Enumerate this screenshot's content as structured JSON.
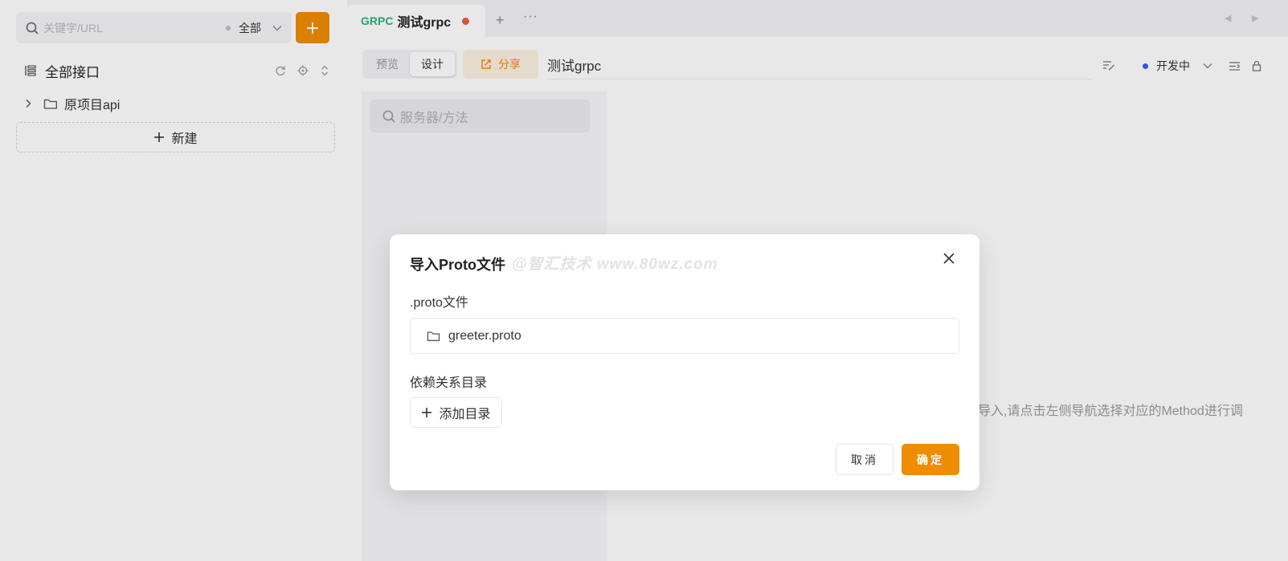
{
  "sidebar": {
    "search": {
      "placeholder": "关键字/URL",
      "filter_value": "全部"
    },
    "add_button_label": "+",
    "tree_title": "全部接口",
    "folder": {
      "label": "原项目api"
    },
    "new_button_label": "新建"
  },
  "tab": {
    "protocol": "GRPC",
    "name": "测试grpc",
    "add_label": "+",
    "more_label": "···"
  },
  "toolbar": {
    "preview_label": "预览",
    "design_label": "设计",
    "share_label": "分享",
    "doc_name": "测试grpc",
    "status_label": "开发中"
  },
  "content": {
    "service_search_placeholder": "服务器/方法",
    "empty_hint": "导入,请点击左侧导航选择对应的Method进行调"
  },
  "modal": {
    "title": "导入Proto文件",
    "watermark": "@智汇技术 www.80wz.com",
    "proto_label": ".proto文件",
    "proto_file": "greeter.proto",
    "deps_label": "依赖关系目录",
    "add_dir_label": "添加目录",
    "cancel_label": "取消",
    "ok_label": "确定"
  },
  "colors": {
    "accent": "#f08c00",
    "grpc_green": "#27b57a",
    "dirty_red": "#f25a3c",
    "status_blue": "#3c5cf0"
  }
}
